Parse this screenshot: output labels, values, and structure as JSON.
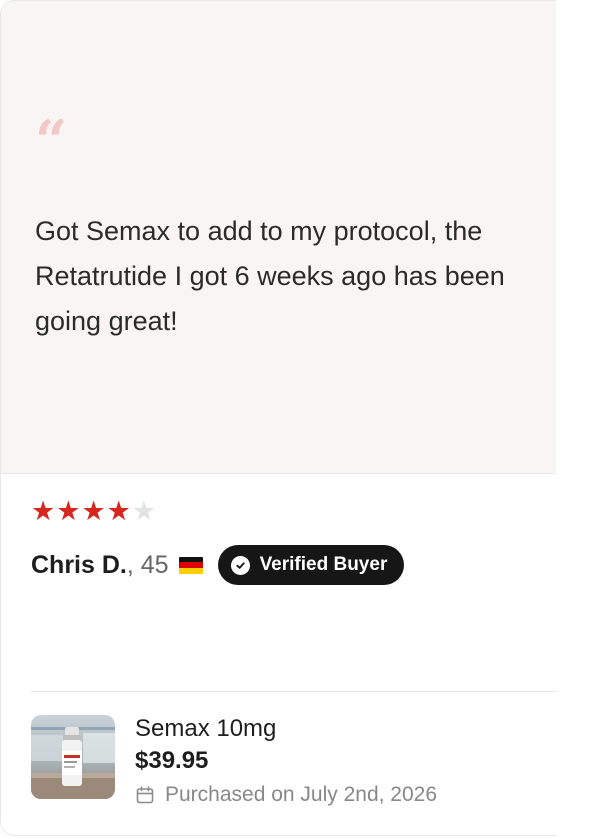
{
  "review": {
    "quote_mark": "“",
    "text": "Got Semax to add to my protocol, the Retatrutide I got 6 weeks ago has been going great!",
    "rating": 4,
    "max_rating": 5,
    "reviewer_name": "Chris D.",
    "reviewer_age_text": ", 45",
    "country_flag": "germany-flag-icon",
    "verified_label": "Verified Buyer"
  },
  "product": {
    "name": "Semax 10mg",
    "price": "$39.95",
    "purchase_text": "Purchased on July 2nd, 2026"
  },
  "colors": {
    "star_filled": "#d7261e",
    "star_empty": "#e2e2e2",
    "quote_panel_bg": "#f9f5f4",
    "quote_mark": "#f2c9c6",
    "badge_bg": "#161616"
  }
}
